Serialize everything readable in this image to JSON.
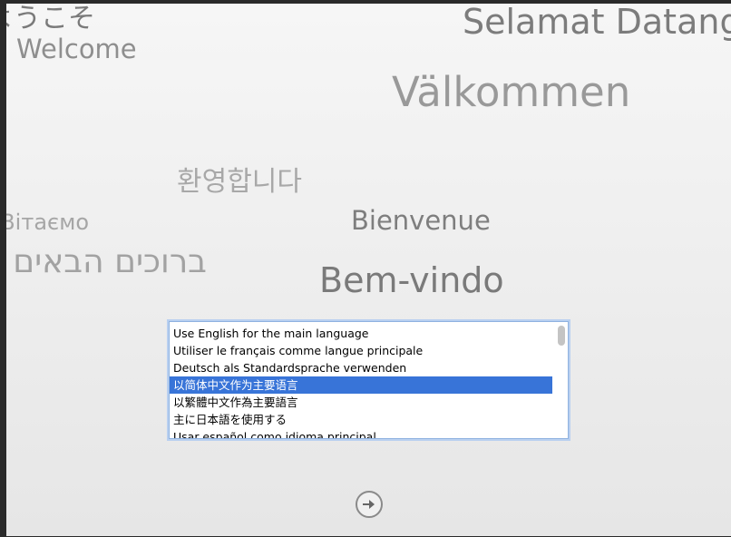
{
  "welcome_words": {
    "japanese": "ようこそ",
    "english": "Welcome",
    "indonesian": "Selamat Datang",
    "swedish": "Välkommen",
    "korean": "환영합니다",
    "ukrainian": "Вітаємо",
    "hebrew": "ברוכים הבאים",
    "french": "Bienvenue",
    "portuguese": "Bem-vindo"
  },
  "language_list": {
    "selected_index": 3,
    "items": [
      "Use English for the main language",
      "Utiliser le français comme langue principale",
      "Deutsch als Standardsprache verwenden",
      "以简体中文作为主要语言",
      "以繁體中文作為主要語言",
      "主に日本語を使用する",
      "Usar español como idioma principal"
    ]
  },
  "next_button": {
    "icon": "arrow-right-circle-icon"
  }
}
